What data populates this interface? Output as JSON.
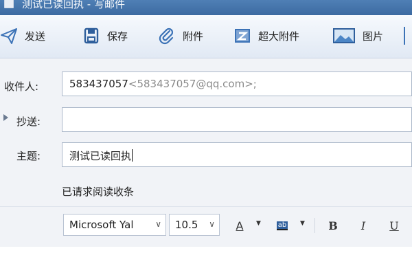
{
  "window": {
    "title": "测试已读回执 - 写邮件"
  },
  "toolbar": {
    "send": "发送",
    "save": "保存",
    "attach": "附件",
    "super_attach": "超大附件",
    "image": "图片"
  },
  "fields": {
    "to_label": "收件人:",
    "to_value": "583437057",
    "to_hint": "<583437057@qq.com>;",
    "cc_label": "抄送:",
    "cc_value": "",
    "subject_label": "主题:",
    "subject_value": "测试已读回执",
    "read_receipt_notice": "已请求阅读收条"
  },
  "format": {
    "font_family": "Microsoft Yal",
    "font_size": "10.5",
    "font_color_label": "A",
    "highlight_label": "ab",
    "bold_label": "B",
    "italic_label": "I",
    "underline_label": "U"
  },
  "colors": {
    "title_bar": "#3c6aa1",
    "toolbar_bg": "#e8eef6",
    "accent_icon": "#3b72b6"
  },
  "icons": [
    "document-icon",
    "send-icon",
    "save-icon",
    "paperclip-icon",
    "super-attachment-icon",
    "image-icon"
  ]
}
